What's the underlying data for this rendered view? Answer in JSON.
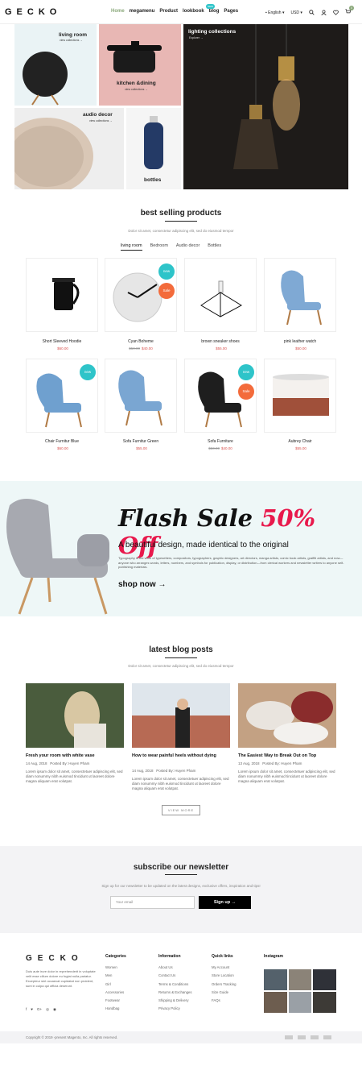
{
  "header": {
    "logo": "GECKO",
    "nav": [
      "Home",
      "megamenu",
      "Product",
      "lookbook",
      "blog",
      "Pages"
    ],
    "hot_badge": "NEW",
    "language": "English",
    "currency": "USD",
    "cart_count": "0"
  },
  "banner": {
    "living": {
      "title": "living room",
      "sub": "view collections →"
    },
    "kitchen": {
      "title": "kitchen &dining",
      "sub": "view collections →"
    },
    "audio": {
      "title": "audio decor",
      "sub": "view collections →"
    },
    "bottles": {
      "title": "bottles"
    },
    "lighting": {
      "title": "lighting collections",
      "sub": "Explorer →"
    }
  },
  "bestselling": {
    "title": "best selling products",
    "subtitle": "Dolor sit amet, consectetur adipiscing elit, sed do eiusmod tempor",
    "tabs": [
      "living room",
      "Bedroom",
      "Audio decor",
      "Bottles"
    ],
    "products": [
      {
        "name": "Short Sleeved Hoodie",
        "old": "",
        "price": "$60.00"
      },
      {
        "name": "Cyan Boheme",
        "old": "$50.00",
        "price": "$40.00"
      },
      {
        "name": "brown sneaker shoes",
        "old": "",
        "price": "$55.00"
      },
      {
        "name": "pink leather watch",
        "old": "",
        "price": "$50.00"
      },
      {
        "name": "Chair Furnitur Blue",
        "old": "",
        "price": "$60.00"
      },
      {
        "name": "Sofa Furnitur Green",
        "old": "",
        "price": "$55.00"
      },
      {
        "name": "Sofa Furniture",
        "old": "$50.00",
        "price": "$40.00"
      },
      {
        "name": "Aubrey Chair",
        "old": "",
        "price": "$55.00"
      }
    ],
    "badge_new": "new",
    "badge_sale": "Sale"
  },
  "flash": {
    "title_a": "Flash Sale ",
    "title_b": "50% Off",
    "subtitle": "A beautiful design, made identical to the original",
    "text": "Typography is the work of typesetters, compositors, typographers, graphic designers, art directors, manga artists, comic book artists, graffiti artists, and now—anyone who arranges words, letters, numbers, and symbols for publication, display, or distribution—from clerical workers and newsletter writers to anyone self-publishing materials.",
    "cta": "shop now →"
  },
  "blog": {
    "title": "latest blog posts",
    "subtitle": "Dolor sit amet, consectetur adipiscing elit, sed do eiusmod tempor",
    "posts": [
      {
        "title": "Fresh your room with white vase",
        "date": "14 Aug, 2018",
        "author": "Posted By: Huyen Pham",
        "excerpt": "Lorem ipsum dolor sit amet, consectetuer adipiscing elit, sed diam nonummy nibh euismod tincidunt ut laoreet dolore magna aliquam erat volutpat."
      },
      {
        "title": "How to wear painful heels without dying",
        "date": "14 Aug, 2018",
        "author": "Posted By: Huyen Pham",
        "excerpt": "Lorem ipsum dolor sit amet, consectetuer adipiscing elit, sed diam nonummy nibh euismod tincidunt ut laoreet dolore magna aliquam erat volutpat."
      },
      {
        "title": "The Easiest Way to Break Out on Top",
        "date": "13 Aug, 2018",
        "author": "Posted By: Huyen Pham",
        "excerpt": "Lorem ipsum dolor sit amet, consectetuer adipiscing elit, sed diam nonummy nibh euismod tincidunt ut laoreet dolore magna aliquam erat volutpat."
      }
    ],
    "view_more": "VIEW MORE"
  },
  "newsletter": {
    "title": "subscribe our newsletter",
    "text": "Sign up for our newsletter to be updated on the latest designs, exclusive offers, inspiration and tips!",
    "placeholder": "Your email",
    "button": "Sign up →"
  },
  "footer": {
    "logo": "GECKO",
    "about": "Duis aute irure dolor in reprehenderit in voluptate velit esse cillum dolore eu fugiat nulla pariatur. Excepteur sint occaecat cupidatat non proident, sunt in culpa qui officia deserunt.",
    "social": [
      "f",
      "♥",
      "G+",
      "◎",
      "◉"
    ],
    "categories": {
      "title": "Categories",
      "items": [
        "Women",
        "Men",
        "Girl",
        "Accessories",
        "Footwear",
        "Handbag"
      ]
    },
    "information": {
      "title": "Information",
      "items": [
        "About Us",
        "Contact Us",
        "Terms & Conditions",
        "Returns & Exchanges",
        "Shipping & Delivery",
        "Privacy Policy"
      ]
    },
    "quicklinks": {
      "title": "Quick links",
      "items": [
        "My Account",
        "Store Location",
        "Orders Tracking",
        "Size Guide",
        "FAQs"
      ]
    },
    "instagram": {
      "title": "Instagram"
    },
    "copyright": "Copyright © 2019 -present Magento, Inc. All rights reserved."
  },
  "colors": {
    "accent": "#2ec4c9",
    "sale": "#f36b3b",
    "price": "#d9534f",
    "flash_pink": "#e8194c"
  }
}
